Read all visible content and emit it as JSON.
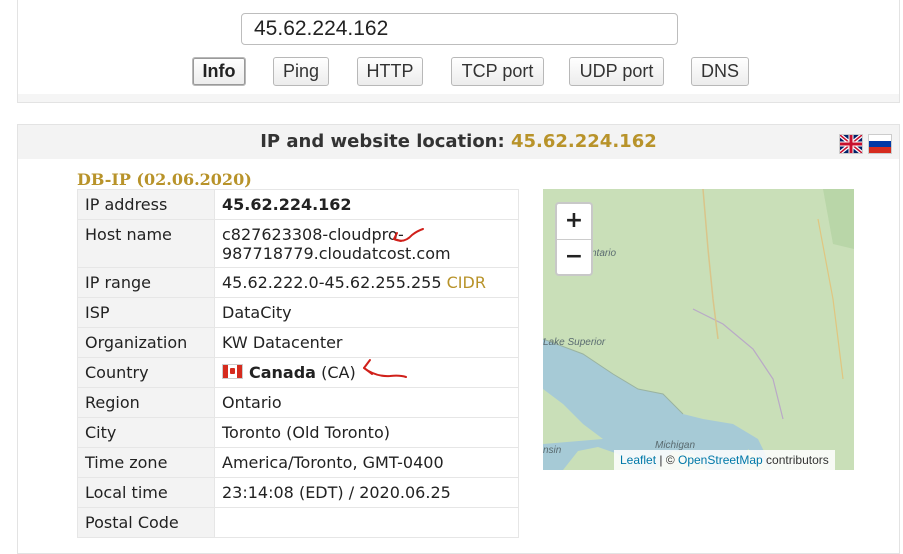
{
  "search": {
    "ip_value": "45.62.224.162"
  },
  "buttons": [
    {
      "label": "Info"
    },
    {
      "label": "Ping"
    },
    {
      "label": "HTTP"
    },
    {
      "label": "TCP port"
    },
    {
      "label": "UDP port"
    },
    {
      "label": "DNS"
    }
  ],
  "header": {
    "title_prefix": "IP and website location:",
    "title_ip": "45.62.224.162"
  },
  "db": {
    "title": "DB-IP (02.06.2020)"
  },
  "rows": {
    "ip_address": {
      "label": "IP address",
      "value": "45.62.224.162"
    },
    "host_name": {
      "label": "Host name",
      "line1": "c827623308-cloudpro-",
      "line2": "987718779.cloudatcost.com"
    },
    "ip_range": {
      "label": "IP range",
      "value": "45.62.222.0-45.62.255.255",
      "link": "CIDR"
    },
    "isp": {
      "label": "ISP",
      "value": "DataCity"
    },
    "organization": {
      "label": "Organization",
      "value": "KW Datacenter"
    },
    "country": {
      "label": "Country",
      "name": "Canada",
      "code": "(CA)"
    },
    "region": {
      "label": "Region",
      "value": "Ontario"
    },
    "city": {
      "label": "City",
      "value": "Toronto (Old Toronto)"
    },
    "time_zone": {
      "label": "Time zone",
      "value": "America/Toronto, GMT-0400"
    },
    "local_time": {
      "label": "Local time",
      "value": "23:14:08 (EDT) / 2020.06.25"
    },
    "postal_code": {
      "label": "Postal Code",
      "value": ""
    }
  },
  "map": {
    "zoom_in": "+",
    "zoom_out": "−",
    "labels": {
      "ontario": "ntario",
      "lake_superior": "Lake Superior",
      "michigan": "Michigan",
      "wisconsin": "nsin"
    },
    "attribution": {
      "leaflet": "Leaflet",
      "sep": " | © ",
      "osm": "OpenStreetMap",
      "suffix": " contributors"
    }
  },
  "colors": {
    "accent_gold": "#b8932a",
    "annotation_red": "#d0201a",
    "map_water": "#a6cad6",
    "map_land": "#c9dfb8"
  },
  "icons": [
    "uk-flag-icon",
    "russia-flag-icon",
    "canada-flag-icon"
  ]
}
